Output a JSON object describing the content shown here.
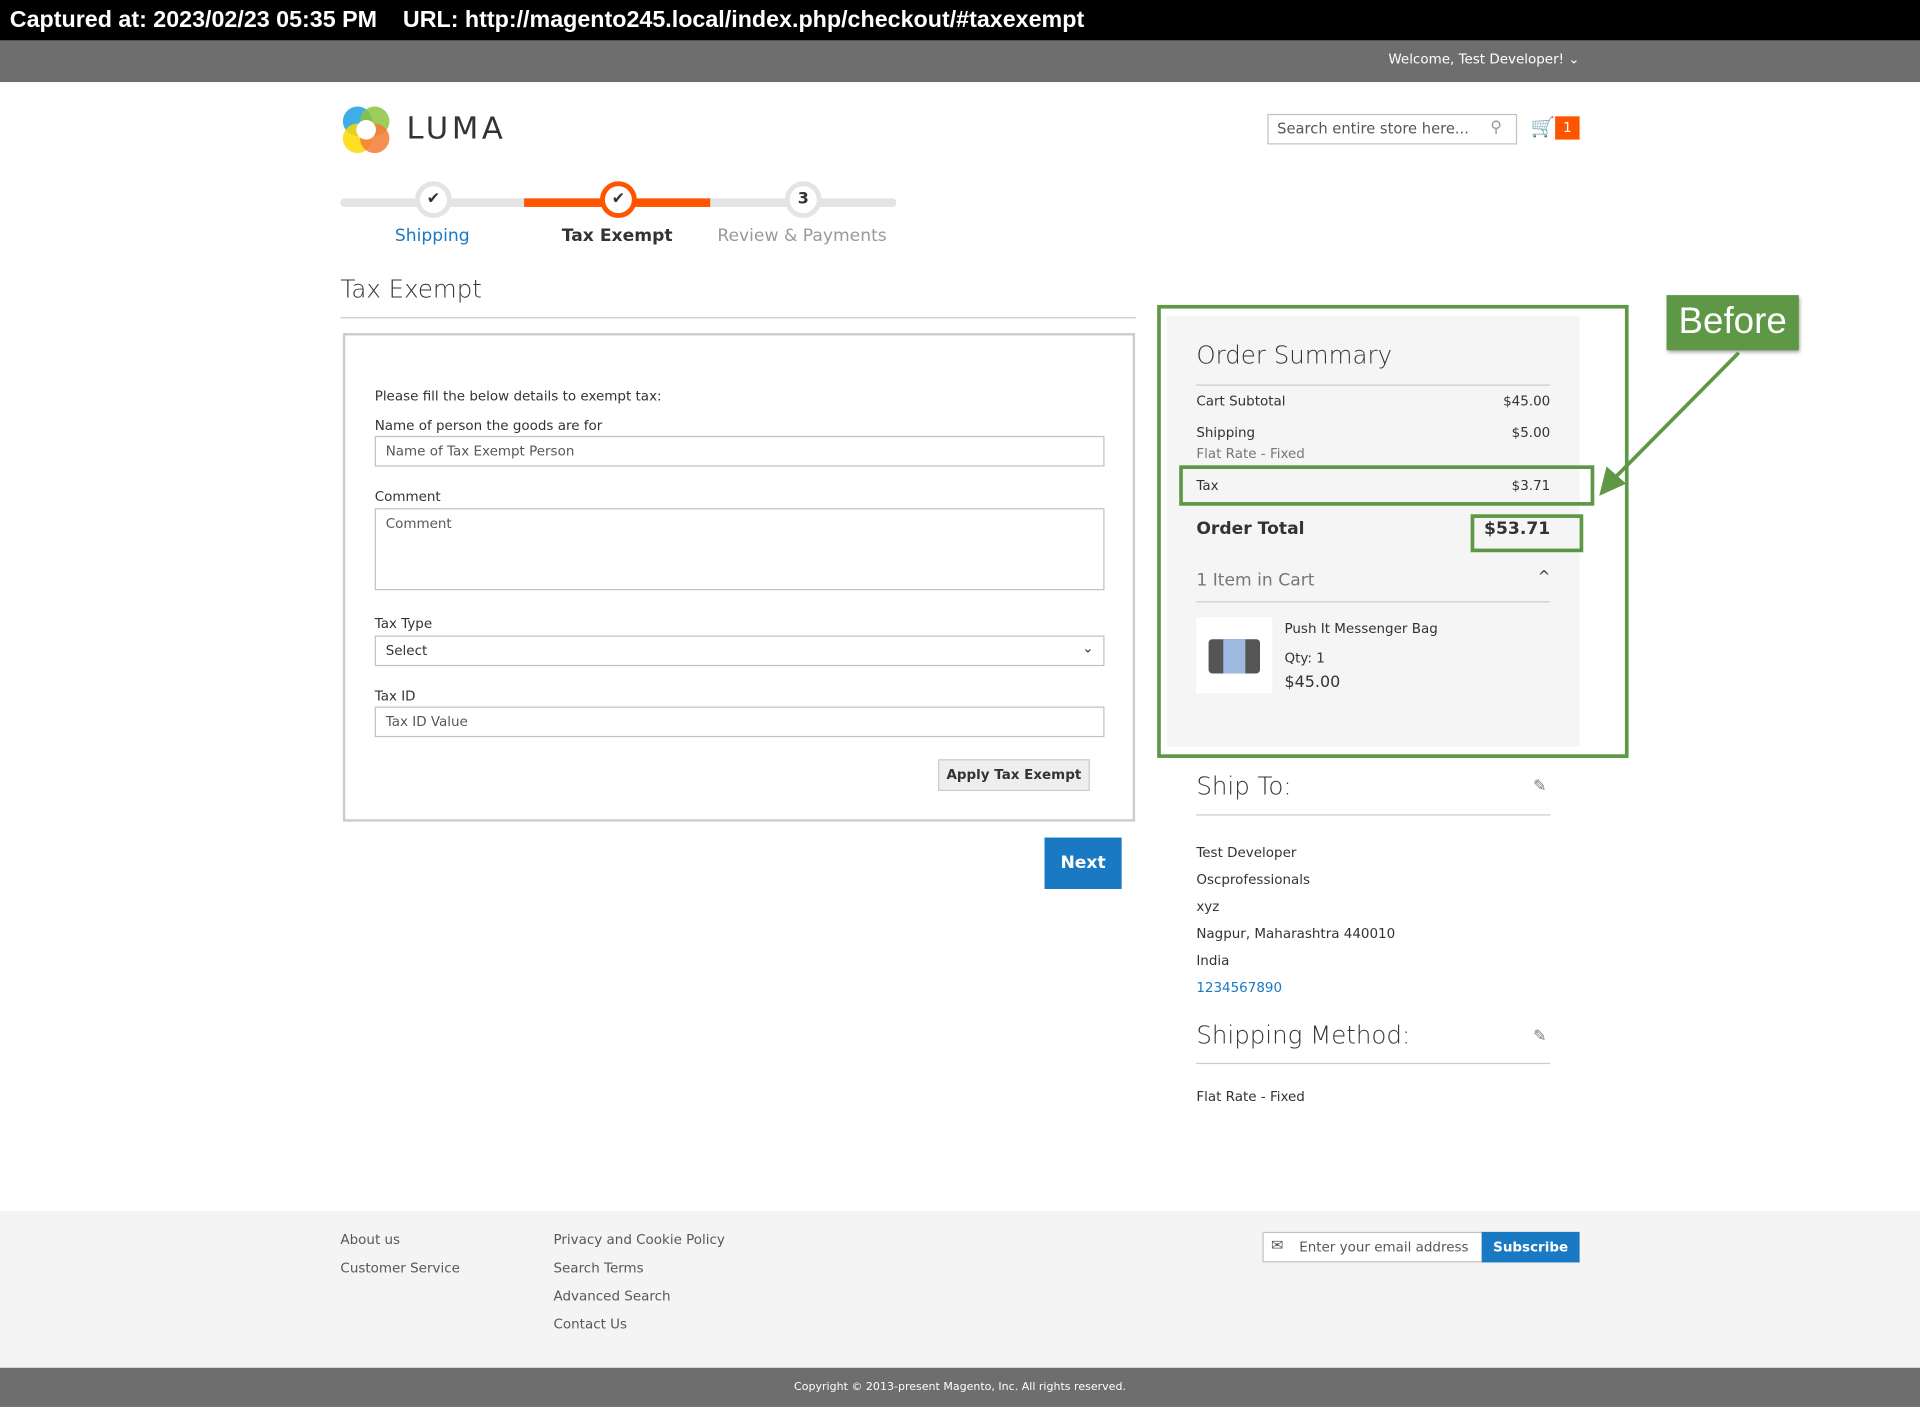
{
  "capture": {
    "text": "Captured at: 2023/02/23 05:35 PM    URL: http://magento245.local/index.php/checkout/#taxexempt"
  },
  "header": {
    "welcome": "Welcome, Test Developer!",
    "logo": "LUMA",
    "search_placeholder": "Search entire store here...",
    "cart_count": "1"
  },
  "progress": {
    "steps": [
      {
        "label": "Shipping",
        "marker": "✔"
      },
      {
        "label": "Tax Exempt",
        "marker": "✔"
      },
      {
        "label": "Review & Payments",
        "marker": "3"
      }
    ]
  },
  "form": {
    "title": "Tax Exempt",
    "intro": "Please fill the below details to exempt tax:",
    "name_label": "Name of person the goods are for",
    "name_placeholder": "Name of Tax Exempt Person",
    "comment_label": "Comment",
    "comment_placeholder": "Comment",
    "taxtype_label": "Tax Type",
    "taxtype_value": "Select",
    "taxid_label": "Tax ID",
    "taxid_placeholder": "Tax ID Value",
    "apply_button": "Apply Tax Exempt",
    "next_button": "Next"
  },
  "summary": {
    "title": "Order Summary",
    "rows": [
      {
        "label": "Cart Subtotal",
        "value": "$45.00"
      },
      {
        "label": "Shipping",
        "value": "$5.00",
        "sub": "Flat Rate - Fixed"
      },
      {
        "label": "Tax",
        "value": "$3.71"
      }
    ],
    "total_label": "Order Total",
    "total_value": "$53.71",
    "items_title": "1 Item in Cart",
    "item": {
      "name": "Push It Messenger Bag",
      "qty": "Qty: 1",
      "price": "$45.00"
    }
  },
  "annotation": {
    "label": "Before",
    "color": "#5e9745"
  },
  "shipto": {
    "title": "Ship To:",
    "lines": [
      "Test Developer",
      "Oscprofessionals",
      "xyz",
      "Nagpur, Maharashtra 440010",
      "India"
    ],
    "phone": "1234567890"
  },
  "method": {
    "title": "Shipping Method:",
    "value": "Flat Rate - Fixed"
  },
  "footer": {
    "col1": [
      "About us",
      "Customer Service"
    ],
    "col2": [
      "Privacy and Cookie Policy",
      "Search Terms",
      "Advanced Search",
      "Contact Us"
    ],
    "email_placeholder": "Enter your email address",
    "subscribe": "Subscribe",
    "copyright": "Copyright © 2013-present Magento, Inc. All rights reserved."
  },
  "colors": {
    "accent": "#ff5501",
    "primary": "#1979c3",
    "annotation": "#5e9745"
  }
}
